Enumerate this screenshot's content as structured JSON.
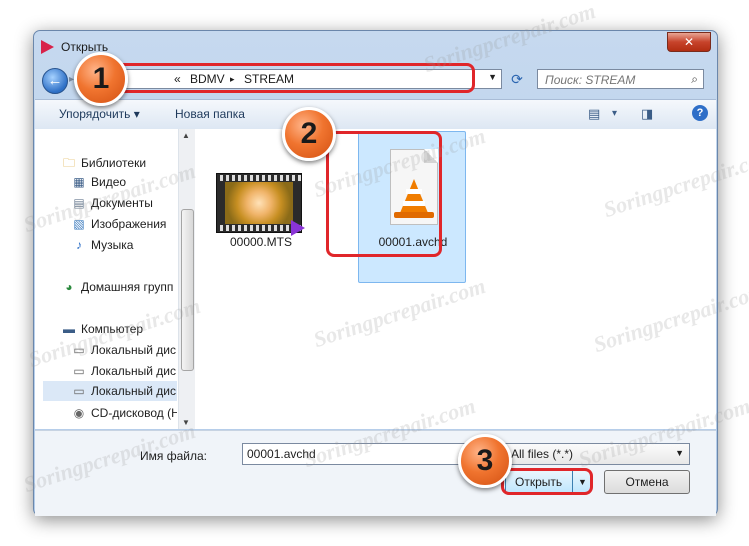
{
  "window": {
    "title": "Открыть",
    "close_glyph": "✕"
  },
  "navigation": {
    "back_glyph": "←",
    "forward_glyph": "▸",
    "breadcrumb_prefix": "«",
    "breadcrumb": [
      "BDMV",
      "STREAM"
    ],
    "separator": "▸",
    "dropdown_glyph": "▼",
    "refresh_glyph": "⟳",
    "search_placeholder": "Поиск: STREAM",
    "search_glyph": "⌕"
  },
  "toolbar": {
    "organize_label": "Упорядочить ▾",
    "new_folder_label": "Новая папка",
    "view_glyph": "▤",
    "view_menu_glyph": "▾",
    "preview_glyph": "◨",
    "help_glyph": "?"
  },
  "sidebar": {
    "items": [
      {
        "label": "Библиотеки",
        "icon": "folder-icon",
        "glyph": "🗀"
      },
      {
        "label": "Видео",
        "icon": "video-icon",
        "glyph": "▦"
      },
      {
        "label": "Документы",
        "icon": "documents-icon",
        "glyph": "▤"
      },
      {
        "label": "Изображения",
        "icon": "pictures-icon",
        "glyph": "▧"
      },
      {
        "label": "Музыка",
        "icon": "music-icon",
        "glyph": "♪"
      },
      {
        "label": "Домашняя групп",
        "icon": "homegroup-icon",
        "glyph": "◕"
      },
      {
        "label": "Компьютер",
        "icon": "computer-icon",
        "glyph": "▬"
      },
      {
        "label": "Локальный дис",
        "icon": "disk-icon",
        "glyph": "▭"
      },
      {
        "label": "Локальный дис",
        "icon": "disk-icon",
        "glyph": "▭"
      },
      {
        "label": "Локальный дис",
        "icon": "disk-icon",
        "glyph": "▭"
      },
      {
        "label": "CD-дисковод (H",
        "icon": "cd-drive-icon",
        "glyph": "◉"
      }
    ],
    "selected_index": 9,
    "scroll_up_glyph": "▲",
    "scroll_down_glyph": "▼"
  },
  "files": [
    {
      "name": "00000.MTS",
      "icon": "video-thumbnail-icon"
    },
    {
      "name": "00001.avchd",
      "icon": "vlc-cone-icon"
    }
  ],
  "footer": {
    "filename_label": "Имя файла:",
    "filename_value": "00001.avchd",
    "filetype_value": "All files (*.*)",
    "filetype_arrow": "▼",
    "open_label": "Открыть",
    "open_arrow": "▼",
    "cancel_label": "Отмена"
  },
  "callouts": [
    "1",
    "2",
    "3"
  ],
  "watermark": "Soringpcrepair.com",
  "colors": {
    "highlight_red": "#e0262a",
    "callout_orange": "#f0742f",
    "selection_blue": "#cce8ff"
  }
}
